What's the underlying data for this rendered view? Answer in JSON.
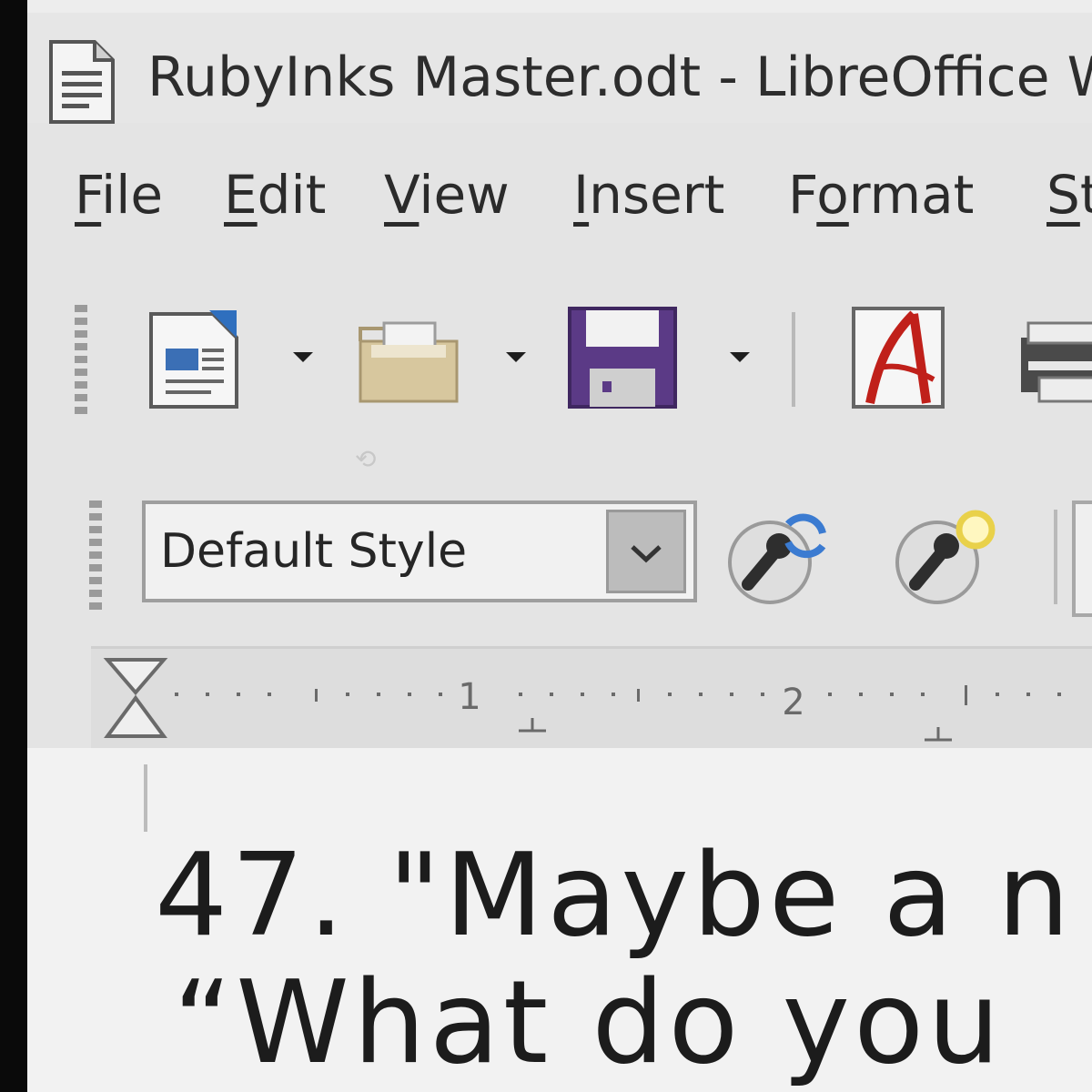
{
  "window": {
    "title": "RubyInks Master.odt - LibreOffice W"
  },
  "menubar": {
    "items": [
      {
        "label_ul": "F",
        "label_rest": "ile"
      },
      {
        "label_ul": "E",
        "label_rest": "dit"
      },
      {
        "label_ul": "V",
        "label_rest": "iew"
      },
      {
        "label_ul": "I",
        "label_rest": "nsert"
      },
      {
        "label_pre": "F",
        "label_ul": "o",
        "label_rest": "rmat"
      },
      {
        "label_ul": "S",
        "label_rest": "t"
      }
    ]
  },
  "toolbar": {
    "icons": [
      "new-document-icon",
      "open-folder-icon",
      "save-icon",
      "export-pdf-icon",
      "print-icon"
    ]
  },
  "formatting": {
    "paragraph_style": "Default Style",
    "icons": [
      "update-style-icon",
      "new-style-icon"
    ]
  },
  "ruler": {
    "labels": [
      "1",
      "2"
    ]
  },
  "document": {
    "line1": "47. \"Maybe a n",
    "line2": "“What do you"
  },
  "colors": {
    "save_purple": "#5b3a86",
    "pdf_red": "#c0201a",
    "folder_tan": "#d7c79e",
    "style_icon_blue": "#3b7bd1",
    "style_icon_yellow": "#e9d14a"
  }
}
